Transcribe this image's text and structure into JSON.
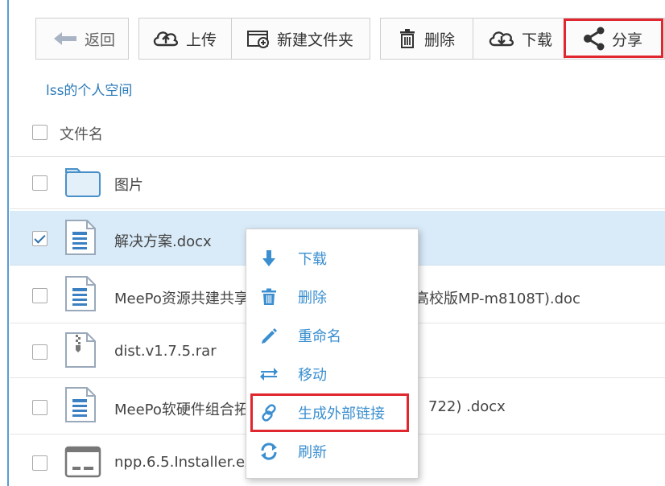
{
  "toolbar": {
    "back_label": "返回",
    "upload_label": "上传",
    "new_folder_label": "新建文件夹",
    "delete_label": "删除",
    "download_label": "下载",
    "share_label": "分享"
  },
  "breadcrumb": "lss的个人空间",
  "list": {
    "header_label": "文件名",
    "files": [
      {
        "name": "图片",
        "icon": "folder-icon",
        "selected": false
      },
      {
        "name": "解决方案.docx",
        "icon": "document-icon",
        "selected": true
      },
      {
        "name": "MeePo资源共建共享",
        "tail": "高校版MP-m8108T).doc",
        "icon": "document-icon",
        "selected": false
      },
      {
        "name": "dist.v1.7.5.rar",
        "icon": "archive-icon",
        "selected": false
      },
      {
        "name": "MeePo软硬件组合拓",
        "tail": "722) .docx",
        "icon": "document-icon",
        "selected": false
      },
      {
        "name": "npp.6.5.Installer.ex",
        "icon": "installer-icon",
        "selected": false
      }
    ]
  },
  "context_menu": {
    "items": [
      {
        "label": "下载",
        "icon": "download-arrow-icon"
      },
      {
        "label": "删除",
        "icon": "trash-icon"
      },
      {
        "label": "重命名",
        "icon": "pencil-icon"
      },
      {
        "label": "移动",
        "icon": "move-arrows-icon"
      },
      {
        "label": "生成外部链接",
        "icon": "link-icon"
      },
      {
        "label": "刷新",
        "icon": "refresh-icon"
      }
    ]
  },
  "colors": {
    "accent": "#3b8fd0",
    "highlight_box": "#e0262e",
    "selected_row": "#d9ebf9"
  }
}
